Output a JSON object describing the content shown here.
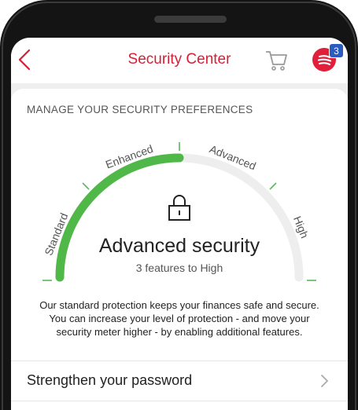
{
  "header": {
    "title": "Security Center",
    "notification_count": "3",
    "icons": {
      "back": "back-chevron-icon",
      "cart": "cart-icon",
      "menu": "menu-icon"
    }
  },
  "preferences": {
    "section_title": "MANAGE YOUR SECURITY PREFERENCES",
    "levels": [
      "Standard",
      "Enhanced",
      "Advanced",
      "High"
    ],
    "current_level_index": 2,
    "meter_fraction": 0.5,
    "current_level_title": "Advanced security",
    "features_to_high": "3 features to High",
    "description": "Our standard protection keeps your finances safe and secure. You can increase your level of protection - and move your security meter higher - by enabling additional features."
  },
  "actions": [
    {
      "label": "Strengthen your password"
    }
  ],
  "colors": {
    "brand_red": "#d81e34",
    "meter_green": "#4fb848",
    "meter_track": "#eeeeee",
    "tick_green": "#5cb85c",
    "badge_blue": "#2b5bbf"
  }
}
